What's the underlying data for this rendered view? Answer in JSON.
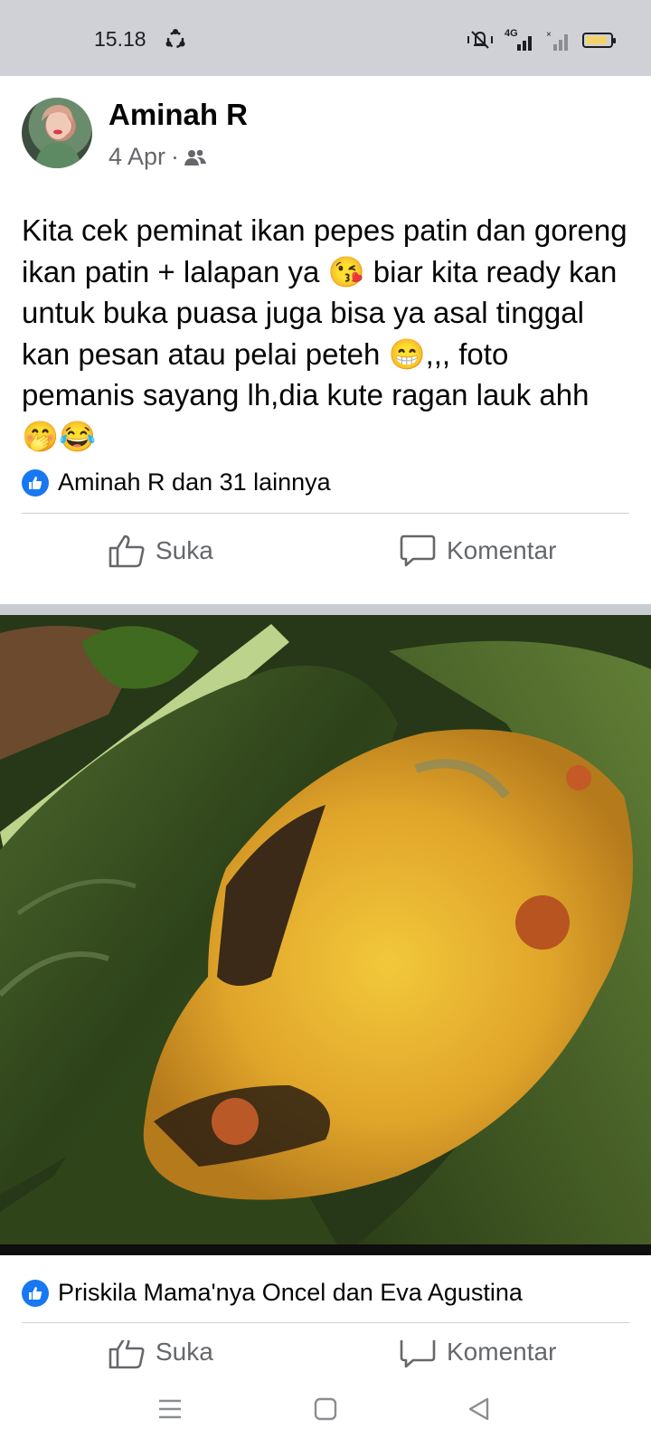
{
  "status_bar": {
    "time": "15.18",
    "network_label": "4G",
    "icons": [
      "sync-icon",
      "vibrate-mute-icon",
      "signal-4g-icon",
      "signal-no-service-icon",
      "battery-icon"
    ],
    "battery_level": 0.9,
    "battery_color": "#f2d56a"
  },
  "post": {
    "author": "Aminah R",
    "date": "4 Apr",
    "date_separator": "·",
    "audience_icon": "friends-icon",
    "text": "Kita cek peminat ikan pepes patin dan goreng ikan patin + lalapan ya 😘 biar kita ready kan untuk buka puasa juga bisa ya asal tinggal kan pesan atau pelai peteh 😁,,, foto pemanis sayang lh,dia kute ragan lauk ahh 🤭😂",
    "reactions_text": "Aminah R dan 31 lainnya",
    "like_label": "Suka",
    "comment_label": "Komentar"
  },
  "photo": {
    "description_icon": "food-photo",
    "reactions_text": "Priskila Mama'nya Oncel dan Eva Agustina",
    "like_label": "Suka",
    "comment_label": "Komentar"
  },
  "colors": {
    "accent": "#1877f2",
    "secondary_text": "#65676b",
    "status_bar_bg": "#cfd1d6"
  }
}
